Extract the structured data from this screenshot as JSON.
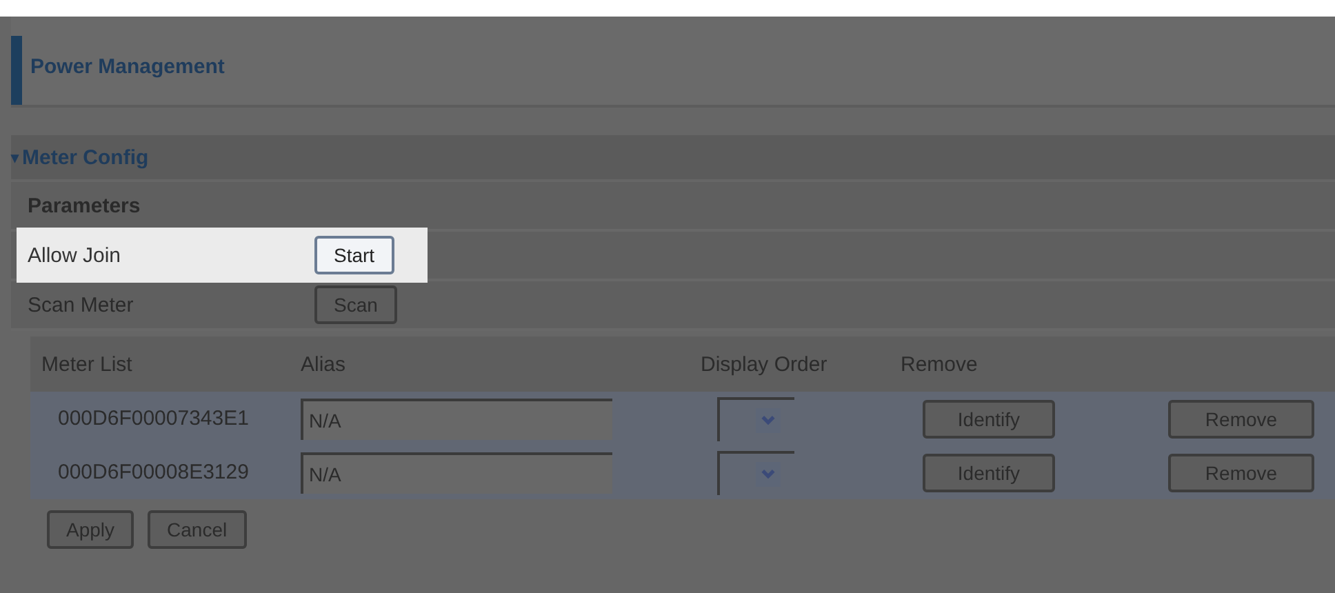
{
  "page": {
    "title": "Power Management"
  },
  "section": {
    "title": "Meter Config",
    "expanded": true,
    "caret": "▾"
  },
  "parameters": {
    "heading": "Parameters",
    "rows": [
      {
        "label": "Allow Join",
        "button": "Start",
        "highlighted": true
      },
      {
        "label": "Scan Meter",
        "button": "Scan",
        "highlighted": false
      }
    ]
  },
  "meter_table": {
    "columns": [
      "Meter List",
      "Alias",
      "Display Order",
      "Remove"
    ],
    "rows": [
      {
        "meter_id": "000D6F00007343E1",
        "alias": "N/A",
        "identify": "Identify",
        "remove": "Remove"
      },
      {
        "meter_id": "000D6F00008E3129",
        "alias": "N/A",
        "identify": "Identify",
        "remove": "Remove"
      }
    ]
  },
  "buttons": [
    "Apply",
    "Cancel"
  ]
}
